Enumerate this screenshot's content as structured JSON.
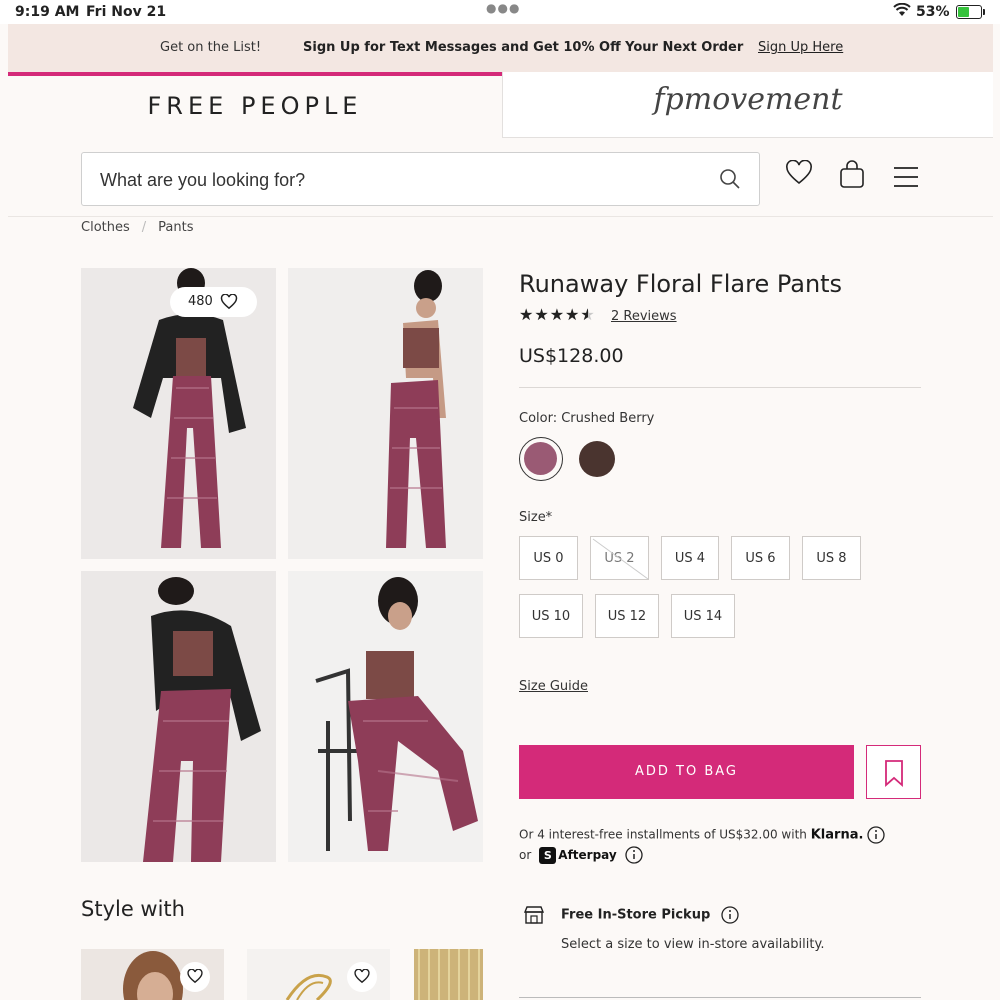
{
  "status_bar": {
    "time": "9:19 AM",
    "date": "Fri Nov 21",
    "battery": "53%",
    "battery_level": 0.53
  },
  "promo": {
    "lead": "Get on the List!",
    "message": "Sign Up for Text Messages and Get 10% Off Your Next Order",
    "cta": "Sign Up Here"
  },
  "brands": {
    "primary": "FREE PEOPLE",
    "secondary": "fpmovement"
  },
  "search": {
    "placeholder": "What are you looking for?"
  },
  "breadcrumb": [
    "Clothes",
    "Pants"
  ],
  "gallery": {
    "likes": "480"
  },
  "product": {
    "title": "Runaway Floral Flare Pants",
    "rating": 4.5,
    "stars": "★★★★★",
    "reviews": "2 Reviews",
    "price": "US$128.00",
    "color_label": "Color: Crushed Berry",
    "swatches": [
      {
        "name": "Crushed Berry",
        "color": "#9a5a74",
        "selected": true
      },
      {
        "name": "Dark",
        "color": "#4a342f",
        "selected": false
      }
    ],
    "size_label": "Size*",
    "sizes": [
      {
        "label": "US 0",
        "available": true
      },
      {
        "label": "US 2",
        "available": false
      },
      {
        "label": "US 4",
        "available": true
      },
      {
        "label": "US 6",
        "available": true
      },
      {
        "label": "US 8",
        "available": true
      },
      {
        "label": "US 10",
        "available": true
      },
      {
        "label": "US 12",
        "available": true
      },
      {
        "label": "US 14",
        "available": true
      }
    ],
    "size_guide": "Size Guide",
    "add_to_bag": "ADD TO BAG",
    "klarna_text": "Or 4 interest-free installments of US$32.00 with",
    "klarna_brand": "Klarna.",
    "afterpay_or": "or",
    "afterpay_brand": "Afterpay",
    "pickup_title": "Free In-Store Pickup",
    "pickup_sub": "Select a size to view in-store availability."
  },
  "style_with": {
    "title": "Style with"
  },
  "colors": {
    "accent": "#d42a79",
    "promo_bg": "#f3e7e2",
    "page_bg": "#fcf9f7"
  }
}
